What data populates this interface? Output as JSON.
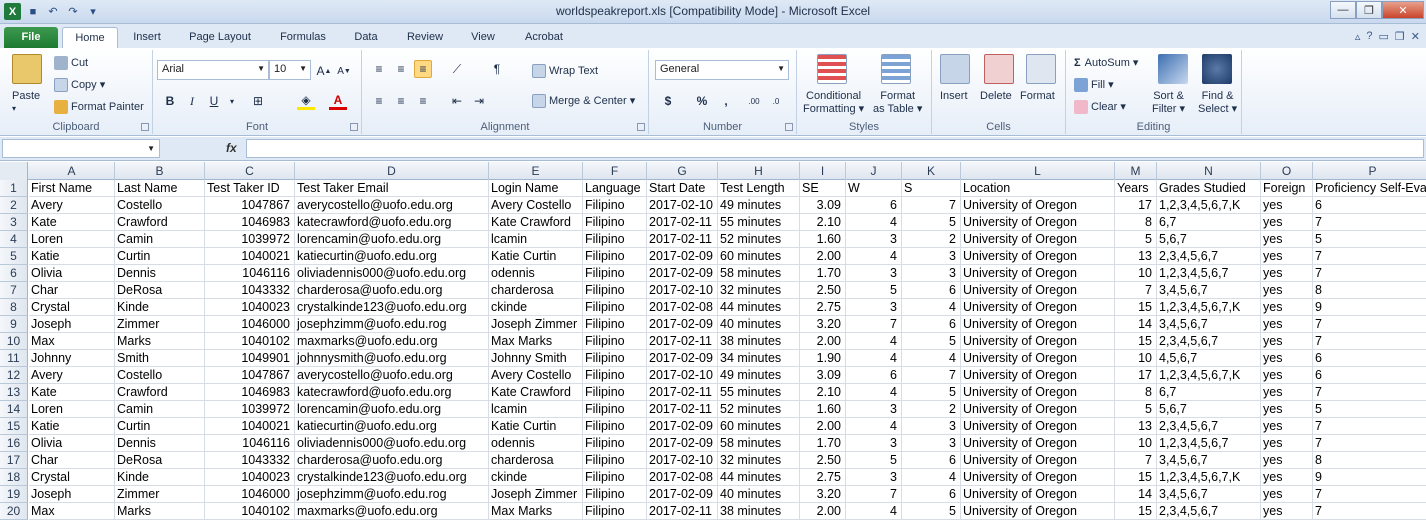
{
  "window": {
    "title": "worldspeakreport.xls  [Compatibility Mode] - Microsoft Excel",
    "app_icon": "X"
  },
  "tabs": [
    "File",
    "Home",
    "Insert",
    "Page Layout",
    "Formulas",
    "Data",
    "Review",
    "View",
    "Acrobat"
  ],
  "clipboard": {
    "paste": "Paste",
    "cut": "Cut",
    "copy": "Copy",
    "format_painter": "Format Painter",
    "label": "Clipboard"
  },
  "font": {
    "name": "Arial",
    "size": "10",
    "bold": "B",
    "italic": "I",
    "underline": "U",
    "label": "Font"
  },
  "alignment": {
    "wrap_text": "Wrap Text",
    "merge_center": "Merge & Center",
    "label": "Alignment"
  },
  "number": {
    "format": "General",
    "currency": "$",
    "percent": "%",
    "comma": ",",
    "label": "Number"
  },
  "styles": {
    "conditional": "Conditional",
    "formatting": "Formatting",
    "format_as": "Format",
    "as_table": "as Table",
    "label": "Styles"
  },
  "cells": {
    "insert": "Insert",
    "delete": "Delete",
    "format": "Format",
    "label": "Cells"
  },
  "editing": {
    "autosum": "AutoSum",
    "fill": "Fill",
    "clear": "Clear",
    "sort": "Sort &",
    "filter": "Filter",
    "find": "Find &",
    "select": "Select",
    "label": "Editing"
  },
  "formula_bar": {
    "name_box": "",
    "fx": "fx",
    "content": ""
  },
  "sheet": {
    "columns": [
      "A",
      "B",
      "C",
      "D",
      "E",
      "F",
      "G",
      "H",
      "I",
      "J",
      "K",
      "L",
      "M",
      "N",
      "O",
      "P"
    ],
    "rows": [
      [
        "First Name",
        "Last Name",
        "Test Taker ID",
        "Test Taker Email",
        "Login Name",
        "Language",
        "Start Date",
        "Test Length",
        "SE",
        "W",
        "S",
        "Location",
        "Years",
        "Grades Studied",
        "Foreign",
        "Proficiency Self-Eva"
      ],
      [
        "Avery",
        "Costello",
        "1047867",
        "averycostello@uofo.edu.org",
        "Avery Costello",
        "Filipino",
        "2017-02-10",
        "49 minutes",
        "3.09",
        "6",
        "7",
        "University of Oregon",
        "17",
        "1,2,3,4,5,6,7,K",
        "yes",
        "6"
      ],
      [
        "Kate",
        "Crawford",
        "1046983",
        "katecrawford@uofo.edu.org",
        "Kate Crawford",
        "Filipino",
        "2017-02-11",
        "55 minutes",
        "2.10",
        "4",
        "5",
        "University of Oregon",
        "8",
        "6,7",
        "yes",
        "7"
      ],
      [
        "Loren",
        "Camin",
        "1039972",
        "lorencamin@uofo.edu.org",
        "lcamin",
        "Filipino",
        "2017-02-11",
        "52 minutes",
        "1.60",
        "3",
        "2",
        "University of Oregon",
        "5",
        "5,6,7",
        "yes",
        "5"
      ],
      [
        "Katie",
        "Curtin",
        "1040021",
        "katiecurtin@uofo.edu.org",
        "Katie Curtin",
        "Filipino",
        "2017-02-09",
        "60 minutes",
        "2.00",
        "4",
        "3",
        "University of Oregon",
        "13",
        "2,3,4,5,6,7",
        "yes",
        "7"
      ],
      [
        "Olivia",
        "Dennis",
        "1046116",
        "oliviadennis000@uofo.edu.org",
        "odennis",
        "Filipino",
        "2017-02-09",
        "58 minutes",
        "1.70",
        "3",
        "3",
        "University of Oregon",
        "10",
        "1,2,3,4,5,6,7",
        "yes",
        "7"
      ],
      [
        "Char",
        "DeRosa",
        "1043332",
        "charderosa@uofo.edu.org",
        "charderosa",
        "Filipino",
        "2017-02-10",
        "32 minutes",
        "2.50",
        "5",
        "6",
        "University of Oregon",
        "7",
        "3,4,5,6,7",
        "yes",
        "8"
      ],
      [
        "Crystal",
        "Kinde",
        "1040023",
        "crystalkinde123@uofo.edu.org",
        "ckinde",
        "Filipino",
        "2017-02-08",
        "44 minutes",
        "2.75",
        "3",
        "4",
        "University of Oregon",
        "15",
        "1,2,3,4,5,6,7,K",
        "yes",
        "9"
      ],
      [
        "Joseph",
        "Zimmer",
        "1046000",
        "josephzimm@uofo.edu.rog",
        "Joseph Zimmer",
        "Filipino",
        "2017-02-09",
        "40 minutes",
        "3.20",
        "7",
        "6",
        "University of Oregon",
        "14",
        "3,4,5,6,7",
        "yes",
        "7"
      ],
      [
        "Max",
        "Marks",
        "1040102",
        "maxmarks@uofo.edu.org",
        "Max Marks",
        "Filipino",
        "2017-02-11",
        "38 minutes",
        "2.00",
        "4",
        "5",
        "University of Oregon",
        "15",
        "2,3,4,5,6,7",
        "yes",
        "7"
      ],
      [
        "Johnny",
        "Smith",
        "1049901",
        "johnnysmith@uofo.edu.org",
        "Johnny Smith",
        "Filipino",
        "2017-02-09",
        "34 minutes",
        "1.90",
        "4",
        "4",
        "University of Oregon",
        "10",
        "4,5,6,7",
        "yes",
        "6"
      ],
      [
        "Avery",
        "Costello",
        "1047867",
        "averycostello@uofo.edu.org",
        "Avery Costello",
        "Filipino",
        "2017-02-10",
        "49 minutes",
        "3.09",
        "6",
        "7",
        "University of Oregon",
        "17",
        "1,2,3,4,5,6,7,K",
        "yes",
        "6"
      ],
      [
        "Kate",
        "Crawford",
        "1046983",
        "katecrawford@uofo.edu.org",
        "Kate Crawford",
        "Filipino",
        "2017-02-11",
        "55 minutes",
        "2.10",
        "4",
        "5",
        "University of Oregon",
        "8",
        "6,7",
        "yes",
        "7"
      ],
      [
        "Loren",
        "Camin",
        "1039972",
        "lorencamin@uofo.edu.org",
        "lcamin",
        "Filipino",
        "2017-02-11",
        "52 minutes",
        "1.60",
        "3",
        "2",
        "University of Oregon",
        "5",
        "5,6,7",
        "yes",
        "5"
      ],
      [
        "Katie",
        "Curtin",
        "1040021",
        "katiecurtin@uofo.edu.org",
        "Katie Curtin",
        "Filipino",
        "2017-02-09",
        "60 minutes",
        "2.00",
        "4",
        "3",
        "University of Oregon",
        "13",
        "2,3,4,5,6,7",
        "yes",
        "7"
      ],
      [
        "Olivia",
        "Dennis",
        "1046116",
        "oliviadennis000@uofo.edu.org",
        "odennis",
        "Filipino",
        "2017-02-09",
        "58 minutes",
        "1.70",
        "3",
        "3",
        "University of Oregon",
        "10",
        "1,2,3,4,5,6,7",
        "yes",
        "7"
      ],
      [
        "Char",
        "DeRosa",
        "1043332",
        "charderosa@uofo.edu.org",
        "charderosa",
        "Filipino",
        "2017-02-10",
        "32 minutes",
        "2.50",
        "5",
        "6",
        "University of Oregon",
        "7",
        "3,4,5,6,7",
        "yes",
        "8"
      ],
      [
        "Crystal",
        "Kinde",
        "1040023",
        "crystalkinde123@uofo.edu.org",
        "ckinde",
        "Filipino",
        "2017-02-08",
        "44 minutes",
        "2.75",
        "3",
        "4",
        "University of Oregon",
        "15",
        "1,2,3,4,5,6,7,K",
        "yes",
        "9"
      ],
      [
        "Joseph",
        "Zimmer",
        "1046000",
        "josephzimm@uofo.edu.rog",
        "Joseph Zimmer",
        "Filipino",
        "2017-02-09",
        "40 minutes",
        "3.20",
        "7",
        "6",
        "University of Oregon",
        "14",
        "3,4,5,6,7",
        "yes",
        "7"
      ],
      [
        "Max",
        "Marks",
        "1040102",
        "maxmarks@uofo.edu.org",
        "Max Marks",
        "Filipino",
        "2017-02-11",
        "38 minutes",
        "2.00",
        "4",
        "5",
        "University of Oregon",
        "15",
        "2,3,4,5,6,7",
        "yes",
        "7"
      ]
    ]
  },
  "colors": {
    "file_tab": "#1e7a32",
    "highlight": "#ffd981",
    "ribbon_bg": "#dfe9f5"
  }
}
